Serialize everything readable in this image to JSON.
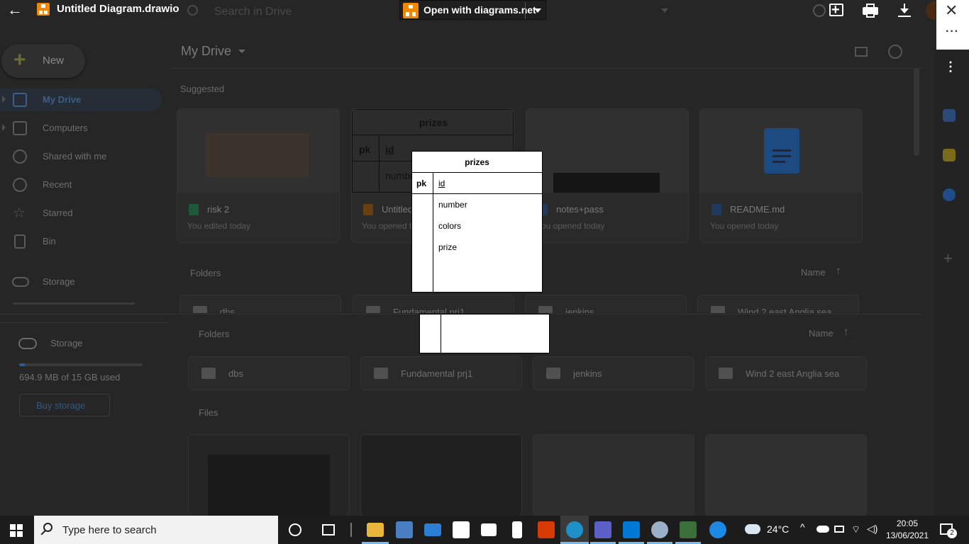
{
  "viewer": {
    "file_title": "Untitled Diagram.drawio",
    "open_with_label": "Open with diagrams.net"
  },
  "drive": {
    "search_placeholder": "Search in Drive",
    "new_label": "New",
    "nav": [
      {
        "label": "My Drive"
      },
      {
        "label": "Computers"
      },
      {
        "label": "Shared with me"
      },
      {
        "label": "Recent"
      },
      {
        "label": "Starred"
      },
      {
        "label": "Bin"
      },
      {
        "label": "Storage"
      }
    ],
    "page_title": "My Drive",
    "suggested_label": "Suggested",
    "suggested": [
      {
        "title": "risk 2",
        "sub": "You edited today"
      },
      {
        "title": "Untitled Diagram.drawio",
        "sub": "You opened today"
      },
      {
        "title": "notes+pass",
        "sub": "You opened today"
      },
      {
        "title": "README.md",
        "sub": "You opened today"
      }
    ],
    "thumb_prizes": {
      "title": "prizes",
      "pk": "pk",
      "id": "id",
      "field": "number"
    },
    "folders_label": "Folders",
    "name_sort_label": "Name",
    "folders": [
      "dbs",
      "Fundamental prj1",
      "jenkins",
      "Wind 2 east Anglia sea"
    ],
    "storage": {
      "label": "Storage",
      "used_text": "694.9 MB of 15 GB used",
      "used_fraction": 0.046,
      "buy_label": "Buy storage"
    },
    "files_label": "Files"
  },
  "diagram": {
    "table_name": "prizes",
    "pk_label": "pk",
    "pk_field": "id",
    "fields": [
      "number",
      "colors",
      "prize"
    ]
  },
  "taskbar": {
    "search_placeholder": "Type here to search",
    "temperature": "24°C",
    "time": "20:05",
    "date": "13/06/2021",
    "notification_count": "2"
  }
}
